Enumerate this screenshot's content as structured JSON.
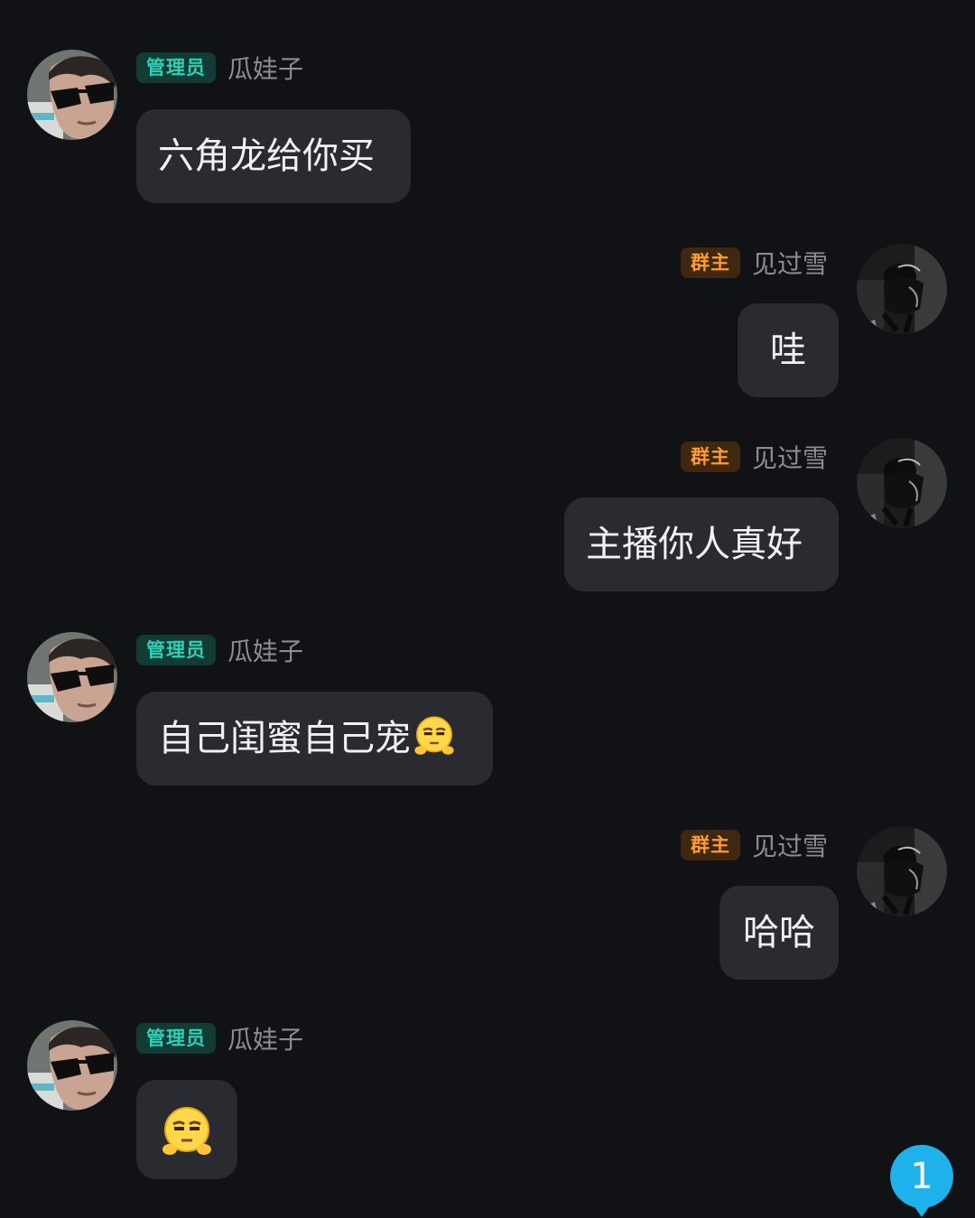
{
  "messages": [
    {
      "side": "left",
      "role": "管理员",
      "name": "瓜娃子",
      "text": "六角龙给你买",
      "emoji": ""
    },
    {
      "side": "right",
      "role": "群主",
      "name": "见过雪",
      "text": "哇",
      "emoji": ""
    },
    {
      "side": "right",
      "role": "群主",
      "name": "见过雪",
      "text": "主播你人真好",
      "emoji": ""
    },
    {
      "side": "left",
      "role": "管理员",
      "name": "瓜娃子",
      "text": "自己闺蜜自己宠",
      "emoji": "smirk-emoji-icon"
    },
    {
      "side": "right",
      "role": "群主",
      "name": "见过雪",
      "text": "哈哈",
      "emoji": ""
    },
    {
      "side": "left",
      "role": "管理员",
      "name": "瓜娃子",
      "text": "",
      "emoji": "smirk-emoji-icon"
    }
  ],
  "unread": {
    "count": "1",
    "color": "#1fb1ea"
  },
  "colors": {
    "background": "#111216",
    "bubble": "#2a2b30",
    "admin_badge_text": "#2bd2b8",
    "owner_badge_text": "#ff9d2b",
    "name_text": "#8c8d93"
  }
}
